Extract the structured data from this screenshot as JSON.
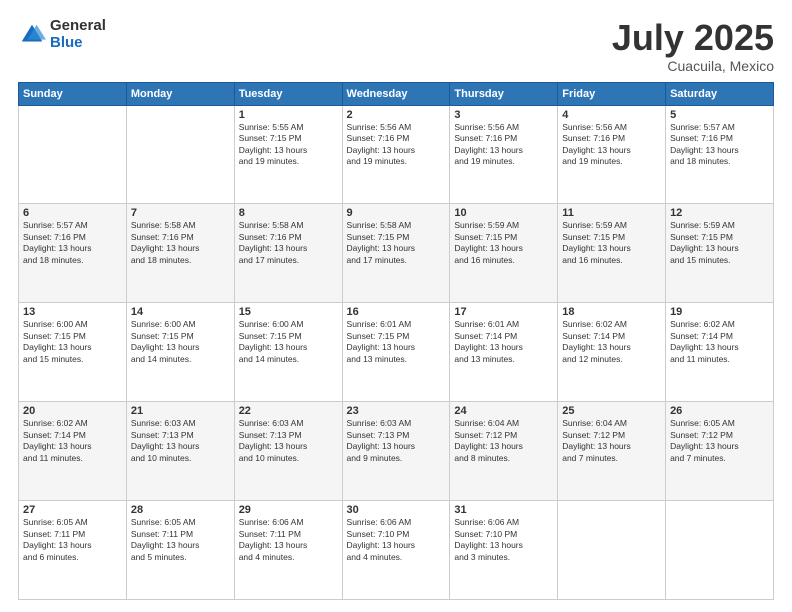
{
  "logo": {
    "general": "General",
    "blue": "Blue"
  },
  "header": {
    "month": "July 2025",
    "location": "Cuacuila, Mexico"
  },
  "weekdays": [
    "Sunday",
    "Monday",
    "Tuesday",
    "Wednesday",
    "Thursday",
    "Friday",
    "Saturday"
  ],
  "weeks": [
    [
      {
        "day": "",
        "info": ""
      },
      {
        "day": "",
        "info": ""
      },
      {
        "day": "1",
        "info": "Sunrise: 5:55 AM\nSunset: 7:15 PM\nDaylight: 13 hours\nand 19 minutes."
      },
      {
        "day": "2",
        "info": "Sunrise: 5:56 AM\nSunset: 7:16 PM\nDaylight: 13 hours\nand 19 minutes."
      },
      {
        "day": "3",
        "info": "Sunrise: 5:56 AM\nSunset: 7:16 PM\nDaylight: 13 hours\nand 19 minutes."
      },
      {
        "day": "4",
        "info": "Sunrise: 5:56 AM\nSunset: 7:16 PM\nDaylight: 13 hours\nand 19 minutes."
      },
      {
        "day": "5",
        "info": "Sunrise: 5:57 AM\nSunset: 7:16 PM\nDaylight: 13 hours\nand 18 minutes."
      }
    ],
    [
      {
        "day": "6",
        "info": "Sunrise: 5:57 AM\nSunset: 7:16 PM\nDaylight: 13 hours\nand 18 minutes."
      },
      {
        "day": "7",
        "info": "Sunrise: 5:58 AM\nSunset: 7:16 PM\nDaylight: 13 hours\nand 18 minutes."
      },
      {
        "day": "8",
        "info": "Sunrise: 5:58 AM\nSunset: 7:16 PM\nDaylight: 13 hours\nand 17 minutes."
      },
      {
        "day": "9",
        "info": "Sunrise: 5:58 AM\nSunset: 7:15 PM\nDaylight: 13 hours\nand 17 minutes."
      },
      {
        "day": "10",
        "info": "Sunrise: 5:59 AM\nSunset: 7:15 PM\nDaylight: 13 hours\nand 16 minutes."
      },
      {
        "day": "11",
        "info": "Sunrise: 5:59 AM\nSunset: 7:15 PM\nDaylight: 13 hours\nand 16 minutes."
      },
      {
        "day": "12",
        "info": "Sunrise: 5:59 AM\nSunset: 7:15 PM\nDaylight: 13 hours\nand 15 minutes."
      }
    ],
    [
      {
        "day": "13",
        "info": "Sunrise: 6:00 AM\nSunset: 7:15 PM\nDaylight: 13 hours\nand 15 minutes."
      },
      {
        "day": "14",
        "info": "Sunrise: 6:00 AM\nSunset: 7:15 PM\nDaylight: 13 hours\nand 14 minutes."
      },
      {
        "day": "15",
        "info": "Sunrise: 6:00 AM\nSunset: 7:15 PM\nDaylight: 13 hours\nand 14 minutes."
      },
      {
        "day": "16",
        "info": "Sunrise: 6:01 AM\nSunset: 7:15 PM\nDaylight: 13 hours\nand 13 minutes."
      },
      {
        "day": "17",
        "info": "Sunrise: 6:01 AM\nSunset: 7:14 PM\nDaylight: 13 hours\nand 13 minutes."
      },
      {
        "day": "18",
        "info": "Sunrise: 6:02 AM\nSunset: 7:14 PM\nDaylight: 13 hours\nand 12 minutes."
      },
      {
        "day": "19",
        "info": "Sunrise: 6:02 AM\nSunset: 7:14 PM\nDaylight: 13 hours\nand 11 minutes."
      }
    ],
    [
      {
        "day": "20",
        "info": "Sunrise: 6:02 AM\nSunset: 7:14 PM\nDaylight: 13 hours\nand 11 minutes."
      },
      {
        "day": "21",
        "info": "Sunrise: 6:03 AM\nSunset: 7:13 PM\nDaylight: 13 hours\nand 10 minutes."
      },
      {
        "day": "22",
        "info": "Sunrise: 6:03 AM\nSunset: 7:13 PM\nDaylight: 13 hours\nand 10 minutes."
      },
      {
        "day": "23",
        "info": "Sunrise: 6:03 AM\nSunset: 7:13 PM\nDaylight: 13 hours\nand 9 minutes."
      },
      {
        "day": "24",
        "info": "Sunrise: 6:04 AM\nSunset: 7:12 PM\nDaylight: 13 hours\nand 8 minutes."
      },
      {
        "day": "25",
        "info": "Sunrise: 6:04 AM\nSunset: 7:12 PM\nDaylight: 13 hours\nand 7 minutes."
      },
      {
        "day": "26",
        "info": "Sunrise: 6:05 AM\nSunset: 7:12 PM\nDaylight: 13 hours\nand 7 minutes."
      }
    ],
    [
      {
        "day": "27",
        "info": "Sunrise: 6:05 AM\nSunset: 7:11 PM\nDaylight: 13 hours\nand 6 minutes."
      },
      {
        "day": "28",
        "info": "Sunrise: 6:05 AM\nSunset: 7:11 PM\nDaylight: 13 hours\nand 5 minutes."
      },
      {
        "day": "29",
        "info": "Sunrise: 6:06 AM\nSunset: 7:11 PM\nDaylight: 13 hours\nand 4 minutes."
      },
      {
        "day": "30",
        "info": "Sunrise: 6:06 AM\nSunset: 7:10 PM\nDaylight: 13 hours\nand 4 minutes."
      },
      {
        "day": "31",
        "info": "Sunrise: 6:06 AM\nSunset: 7:10 PM\nDaylight: 13 hours\nand 3 minutes."
      },
      {
        "day": "",
        "info": ""
      },
      {
        "day": "",
        "info": ""
      }
    ]
  ]
}
